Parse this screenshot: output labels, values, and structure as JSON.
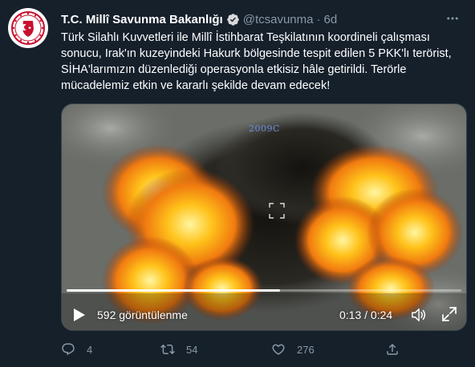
{
  "tweet": {
    "author_name": "T.C. Millî Savunma Bakanlığı",
    "handle": "@tcsavunma",
    "separator": "·",
    "time": "6d",
    "text": "Türk Silahlı Kuvvetleri ile Millî İstihbarat Teşkilatının koordineli çalışması sonucu, Irak'ın kuzeyindeki Hakurk bölgesinde tespit edilen 5 PKK'lı terörist, SİHA'larımızın düzenlediği operasyonla etkisiz hâle getirildi. Terörle mücadelemiz etkin ve kararlı şekilde devam edecek!",
    "icons": {
      "avatar": "ministry-seal",
      "verified": "verified-badge-icon",
      "more": "more-options-icon"
    }
  },
  "video": {
    "overlay_label": "2009C",
    "views": "592 görüntülenme",
    "timecode": "0:13 / 0:24",
    "progress": 0.54,
    "icons": {
      "play": "play-icon",
      "volume": "volume-icon",
      "fullscreen": "fullscreen-icon",
      "crosshair": "crosshair-icon"
    }
  },
  "actions": {
    "reply_count": "4",
    "retweet_count": "54",
    "like_count": "276",
    "icons": {
      "reply": "reply-icon",
      "retweet": "retweet-icon",
      "like": "like-icon",
      "share": "share-icon"
    }
  },
  "colors": {
    "background": "#15202b",
    "muted": "#8b98a5",
    "verified": "#1d9bf0",
    "text": "#ffffff"
  }
}
